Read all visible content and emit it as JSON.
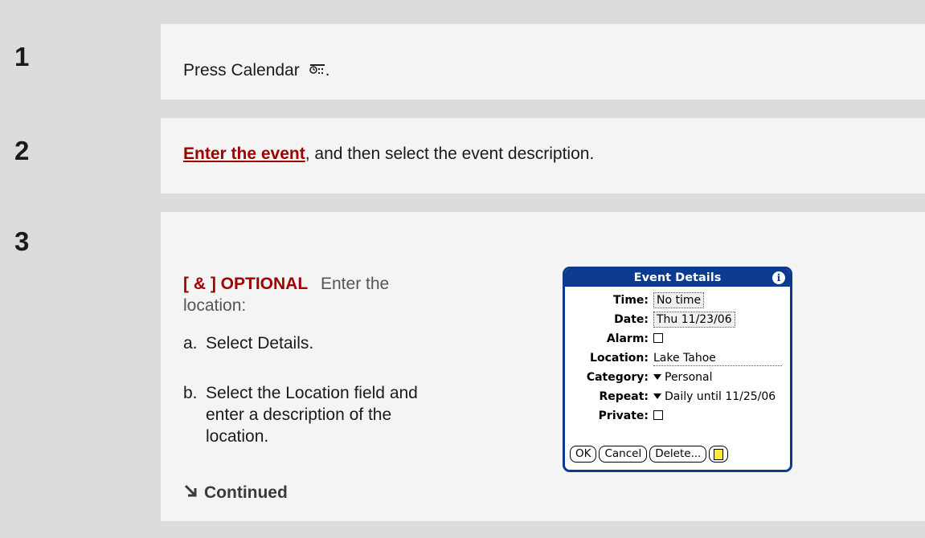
{
  "steps": [
    {
      "number": "1",
      "text_before": "Press Calendar",
      "icon": "calendar-app-icon",
      "text_after": "."
    },
    {
      "number": "2",
      "link_text": "Enter the event",
      "text_after": ", and then select the event description."
    },
    {
      "number": "3",
      "optional_tag": "[ & ]  OPTIONAL",
      "intro_line1": "Enter the",
      "intro_line2": "location:",
      "sub_a_letter": "a.",
      "sub_a_text": "Select Details.",
      "sub_b_letter": "b.",
      "sub_b_text": "Select the Location field and enter a description of the location.",
      "continued": "Continued"
    }
  ],
  "dialog": {
    "title": "Event Details",
    "info_icon": "i",
    "fields": {
      "time_label": "Time:",
      "time_value": "No time",
      "date_label": "Date:",
      "date_value": "Thu 11/23/06",
      "alarm_label": "Alarm:",
      "location_label": "Location:",
      "location_value": "Lake Tahoe",
      "category_label": "Category:",
      "category_value": "Personal",
      "repeat_label": "Repeat:",
      "repeat_value": "Daily until 11/25/06",
      "private_label": "Private:"
    },
    "buttons": {
      "ok": "OK",
      "cancel": "Cancel",
      "delete": "Delete..."
    }
  },
  "colors": {
    "accent_red": "#a00000",
    "dialog_blue": "#0c3a8f"
  }
}
